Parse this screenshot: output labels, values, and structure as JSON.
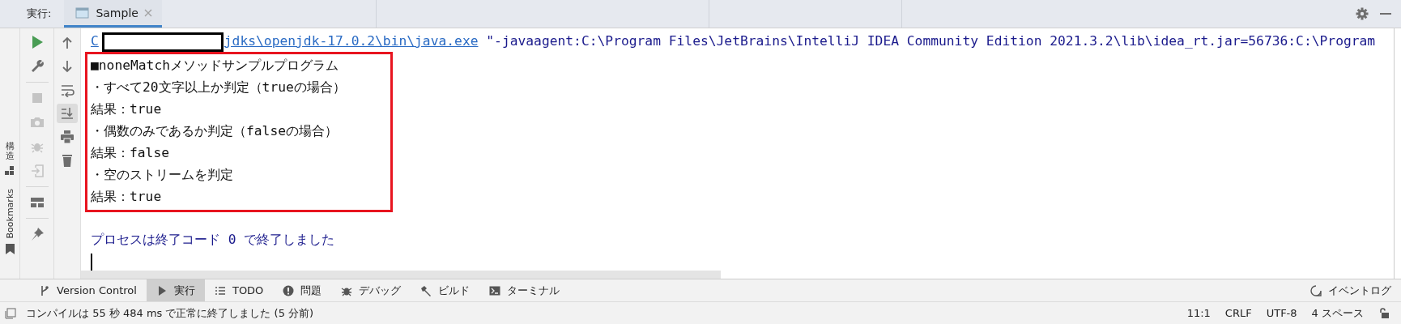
{
  "run_panel": {
    "label": "実行:",
    "tabs": [
      {
        "label": "Sample",
        "selected": true
      }
    ]
  },
  "side_stripe": [
    {
      "kind": "structure",
      "label": "構造"
    },
    {
      "kind": "bookmarks",
      "label": "Bookmarks"
    }
  ],
  "left_tools": [
    {
      "kind": "run",
      "disabled": false
    },
    {
      "kind": "wrench",
      "disabled": false
    },
    {
      "kind": "stop",
      "disabled": true
    },
    {
      "kind": "camera",
      "disabled": true
    },
    {
      "kind": "bug",
      "disabled": true
    },
    {
      "kind": "login",
      "disabled": true
    },
    {
      "kind": "layout",
      "disabled": false
    },
    {
      "kind": "pin",
      "disabled": false
    }
  ],
  "console_tools": [
    {
      "kind": "up",
      "on": false
    },
    {
      "kind": "down",
      "on": false
    },
    {
      "kind": "wrap",
      "on": false
    },
    {
      "kind": "scroll-end",
      "on": true
    },
    {
      "kind": "print",
      "on": false
    },
    {
      "kind": "trash",
      "on": false
    }
  ],
  "console": {
    "command": {
      "prefix": "C",
      "path": "jdks\\openjdk-17.0.2\\bin\\java.exe",
      "args": "\"-javaagent:C:\\Program Files\\JetBrains\\IntelliJ IDEA Community Edition 2021.3.2\\lib\\idea_rt.jar=56736:C:\\Program"
    },
    "output": [
      "■noneMatchメソッドサンプルプログラム",
      "・すべて20文字以上か判定（trueの場合）",
      "結果：true",
      "・偶数のみであるか判定（falseの場合）",
      "結果：false",
      "・空のストリームを判定",
      "結果：true"
    ],
    "exit_message": "プロセスは終了コード 0 で終了しました"
  },
  "tool_tabs": [
    {
      "kind": "vcs",
      "label": "Version Control",
      "selected": false
    },
    {
      "kind": "run",
      "label": "実行",
      "selected": true
    },
    {
      "kind": "list",
      "label": "TODO",
      "selected": false
    },
    {
      "kind": "problems",
      "label": "問題",
      "selected": false
    },
    {
      "kind": "bug",
      "label": "デバッグ",
      "selected": false
    },
    {
      "kind": "hammer",
      "label": "ビルド",
      "selected": false
    },
    {
      "kind": "terminal",
      "label": "ターミナル",
      "selected": false
    }
  ],
  "event_log": "イベントログ",
  "status_bar": {
    "message": "コンパイルは 55 秒 484 ms で正常に終了しました (5 分前)",
    "items": [
      "11:1",
      "CRLF",
      "UTF-8",
      "4 スペース"
    ]
  }
}
